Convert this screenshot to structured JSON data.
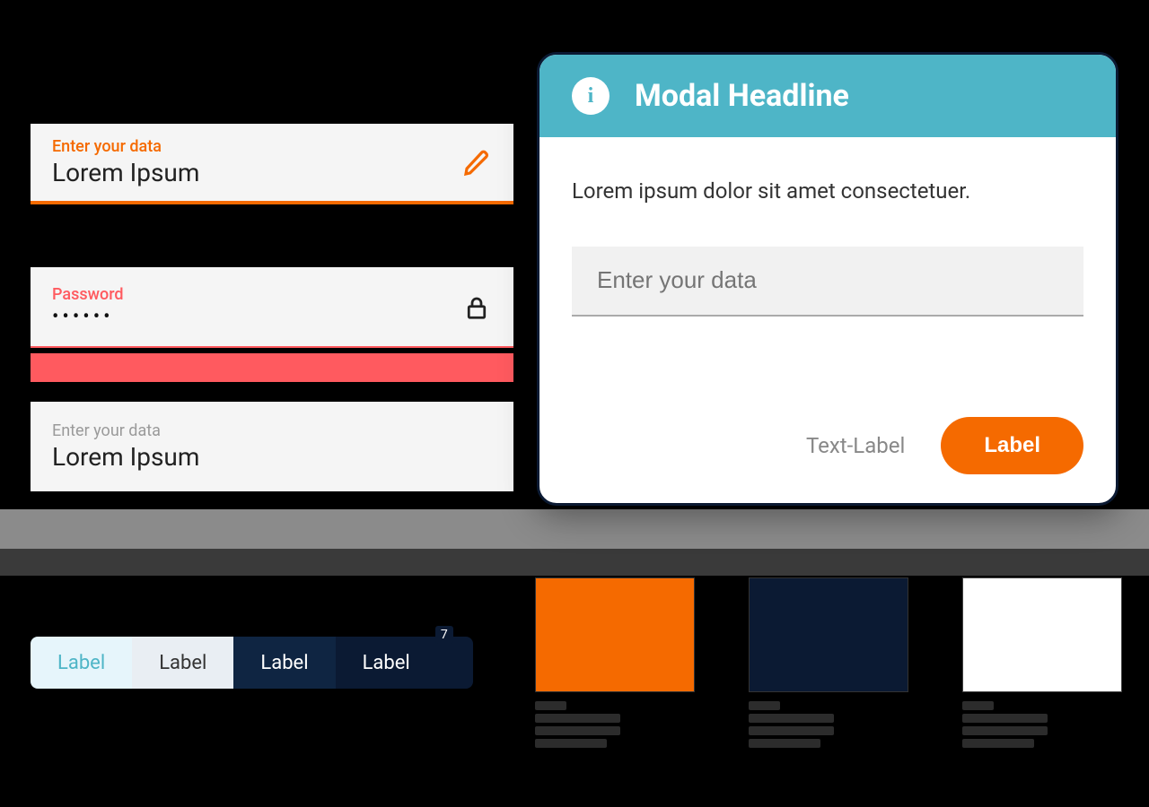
{
  "colors": {
    "accent": "#f56a00",
    "error": "#ff5a5f",
    "navy": "#0b1a33",
    "teal": "#4eb5c7",
    "white": "#ffffff"
  },
  "fields": {
    "active": {
      "label": "Enter your data",
      "value": "Lorem Ipsum",
      "icon": "pencil-icon"
    },
    "password": {
      "label": "Password",
      "value": "••••••",
      "icon": "lock-icon"
    },
    "plain": {
      "label": "Enter your data",
      "value": "Lorem Ipsum"
    }
  },
  "modal": {
    "icon": "info-icon",
    "icon_glyph": "i",
    "title": "Modal Headline",
    "description": "Lorem ipsum dolor sit amet consectetuer.",
    "input_placeholder": "Enter your data",
    "secondary_label": "Text-Label",
    "primary_label": "Label"
  },
  "tabs": {
    "items": [
      {
        "label": "Label"
      },
      {
        "label": "Label"
      },
      {
        "label": "Label"
      },
      {
        "label": "Label",
        "badge": "7"
      }
    ]
  },
  "swatches": [
    {
      "name": "accent-orange",
      "hex": "#f56a00"
    },
    {
      "name": "navy",
      "hex": "#0b1a33"
    },
    {
      "name": "white",
      "hex": "#ffffff"
    }
  ]
}
